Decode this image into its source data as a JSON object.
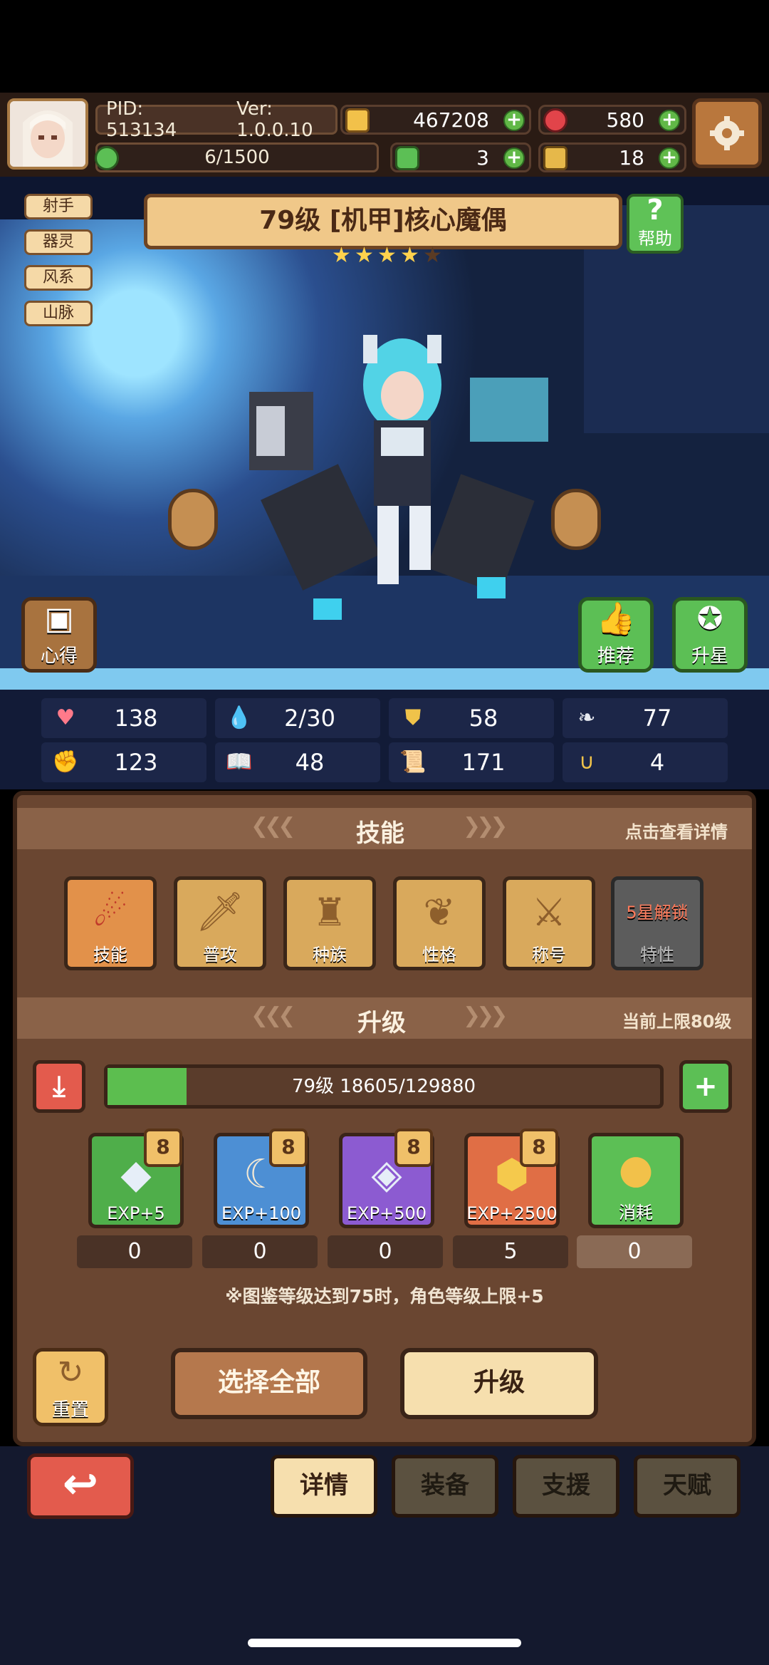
{
  "header": {
    "pid": "PID: 513134",
    "version": "Ver: 1.0.0.10",
    "gold": "467208",
    "gems": "580",
    "stamina": "6/1500",
    "clover": "3",
    "tickets": "18"
  },
  "tags": [
    "射手",
    "器灵",
    "风系",
    "山脉"
  ],
  "hero": {
    "title": "79级 [机甲]核心魔偶",
    "stars_filled": 4,
    "stars_total": 5,
    "help_label": "帮助",
    "left_button": "心得",
    "recommend_button": "推荐",
    "starup_button": "升星"
  },
  "stats": [
    {
      "icon": "heart-icon",
      "value": "138"
    },
    {
      "icon": "water-drop-icon",
      "value": "2/30"
    },
    {
      "icon": "shield-icon",
      "value": "58"
    },
    {
      "icon": "wing-icon",
      "value": "77"
    },
    {
      "icon": "fist-icon",
      "value": "123"
    },
    {
      "icon": "book-icon",
      "value": "48"
    },
    {
      "icon": "scroll-icon",
      "value": "171"
    },
    {
      "icon": "horseshoe-icon",
      "value": "4"
    }
  ],
  "skills_section": {
    "title": "技能",
    "hint": "点击查看详情",
    "items": [
      {
        "label": "技能",
        "icon": "skill-emblem-icon"
      },
      {
        "label": "普攻",
        "icon": "sword-icon"
      },
      {
        "label": "种族",
        "icon": "race-figure-icon"
      },
      {
        "label": "性格",
        "icon": "leaf-icon"
      },
      {
        "label": "称号",
        "icon": "crossed-swords-icon"
      },
      {
        "label": "特性",
        "icon": "locked-trait-icon",
        "lock_text": "5星解锁"
      }
    ]
  },
  "upgrade_section": {
    "title": "升级",
    "hint": "当前上限80级",
    "exp_text": "79级 18605/129880",
    "exp_progress": 0.143,
    "items": [
      {
        "label": "EXP+5",
        "count": "0",
        "icon": "crystal-small-icon",
        "color": "#4fae4a"
      },
      {
        "label": "EXP+100",
        "count": "0",
        "icon": "horn-icon",
        "color": "#4d8fd4"
      },
      {
        "label": "EXP+500",
        "count": "0",
        "icon": "crystal-large-icon",
        "color": "#8c5bd1"
      },
      {
        "label": "EXP+2500",
        "count": "5",
        "icon": "gold-ore-icon",
        "color": "#e06e45"
      },
      {
        "label": "消耗",
        "count": "0",
        "icon": "gold-coin-icon",
        "color": "#5cbf55"
      }
    ],
    "note": "※图鉴等级达到75时，角色等级上限+5"
  },
  "actions": {
    "reset": "重置",
    "select_all": "选择全部",
    "upgrade": "升级"
  },
  "bottom_nav": {
    "tabs": [
      "详情",
      "装备",
      "支援",
      "天赋"
    ],
    "active": 0
  }
}
